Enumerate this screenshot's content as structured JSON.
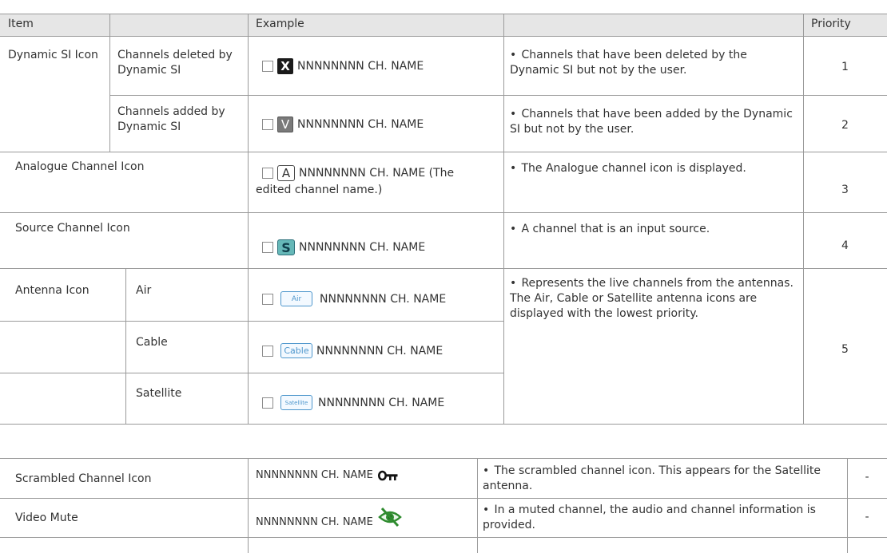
{
  "header": {
    "item": "Item",
    "example": "Example",
    "priority": "Priority"
  },
  "rows": {
    "dyn_si": {
      "label": "Dynamic SI Icon",
      "deleted": {
        "sub": "Channels deleted by Dynamic SI",
        "icon": "X",
        "example": "NNNNNNNN CH. NAME",
        "desc": "Channels that have been deleted by the Dynamic SI but not by the user.",
        "priority": "1"
      },
      "added": {
        "sub": "Channels added by Dynamic SI",
        "icon": "V",
        "example": "NNNNNNNN CH. NAME",
        "desc": "Channels that have been added by the Dynamic SI but not by the user.",
        "priority": "2"
      }
    },
    "analogue": {
      "label": "Analogue Channel Icon",
      "icon": "A",
      "example_line1": "NNNNNNNN CH. NAME (The",
      "example_line2": "edited channel name.)",
      "desc": "The Analogue channel icon is displayed.",
      "priority": "3"
    },
    "source": {
      "label": "Source Channel Icon",
      "icon": "S",
      "example": "NNNNNNNN CH. NAME",
      "desc": "A channel that is an input source.",
      "priority": "4"
    },
    "antenna": {
      "label": "Antenna Icon",
      "desc": "Represents the live channels from the antennas. The Air, Cable or Satellite antenna icons are displayed with the lowest priority.",
      "priority": "5",
      "air": {
        "sub": "Air",
        "icon": "Air",
        "example": "NNNNNNNN CH. NAME"
      },
      "cable": {
        "sub": "Cable",
        "icon": "Cable",
        "example": "NNNNNNNN CH. NAME"
      },
      "satellite": {
        "sub": "Satellite",
        "icon": "Satellite",
        "example": "NNNNNNNN CH. NAME"
      }
    }
  },
  "bottom": {
    "scrambled": {
      "label": "Scrambled Channel Icon",
      "example": "NNNNNNNN CH. NAME",
      "icon_name": "key-icon",
      "desc": "The scrambled channel icon. This appears for the Satellite antenna.",
      "priority": "-"
    },
    "video_mute": {
      "label": "Video Mute",
      "example": "NNNNNNNN CH. NAME",
      "icon_name": "eye-slash-icon",
      "desc": "In a muted channel, the audio and channel information is provided.",
      "priority": "-"
    }
  },
  "colors": {
    "header_bg": "#e6e6e6",
    "rule": "#9a9a9a",
    "icon_blue": "#4d96cc",
    "source_teal": "#66b8b8",
    "mute_green": "#2e8b2e"
  }
}
